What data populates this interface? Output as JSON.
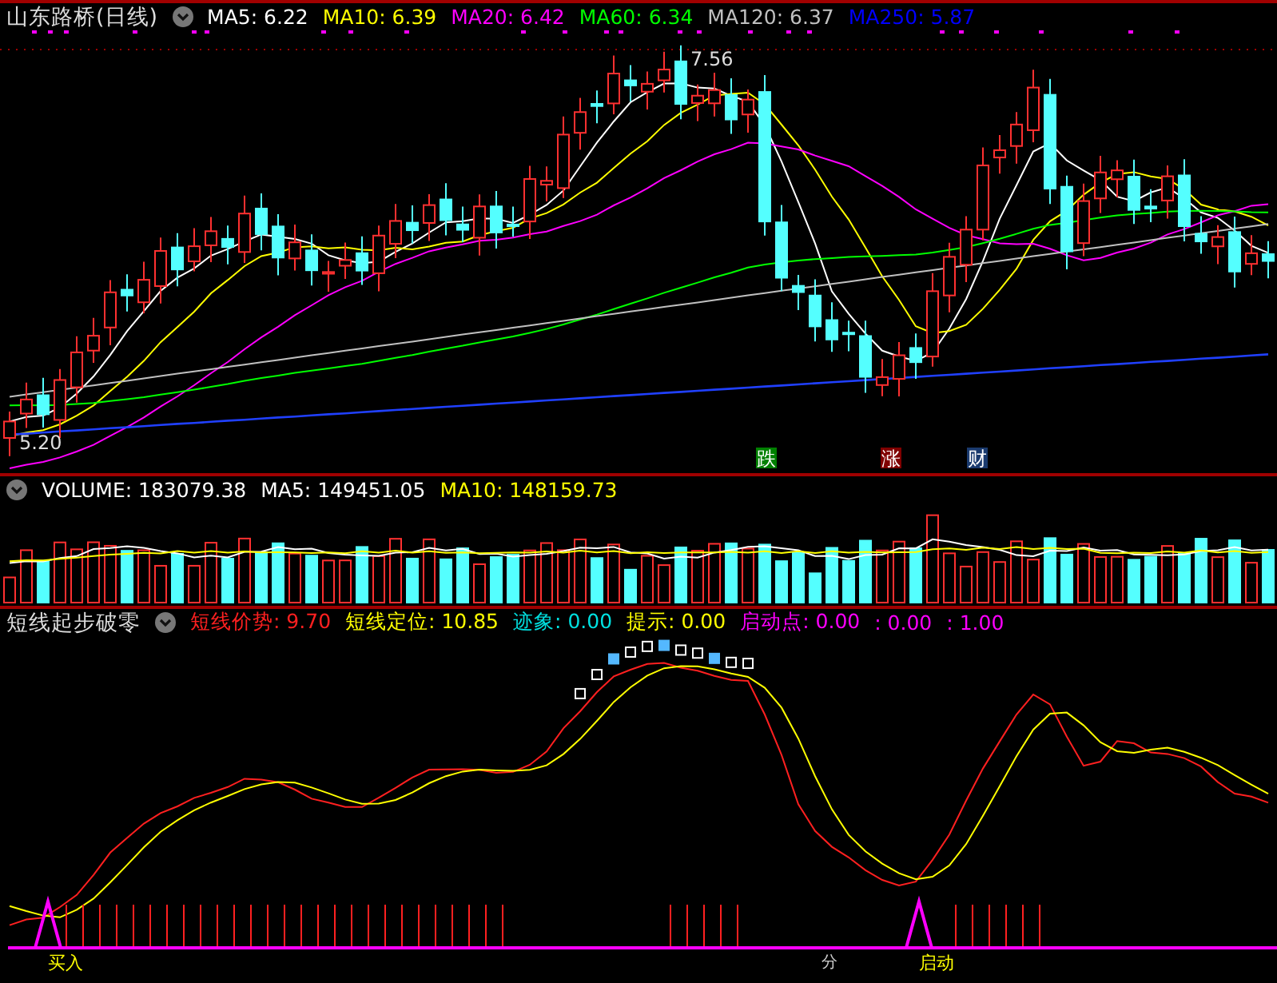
{
  "price_panel": {
    "title": "山东路桥(日线)",
    "indicators": [
      {
        "text": "MA5: 6.22",
        "color": "#ffffff"
      },
      {
        "text": "MA10: 6.39",
        "color": "#ffff00"
      },
      {
        "text": "MA20: 6.42",
        "color": "#ff00ff"
      },
      {
        "text": "MA60: 6.34",
        "color": "#00ff00"
      },
      {
        "text": "MA120: 6.37",
        "color": "#c0c0c0"
      },
      {
        "text": "MA250: 5.87",
        "color": "#0000ff"
      }
    ],
    "high_label": "7.56",
    "low_label": "5.20",
    "signals": [
      {
        "text": "跌",
        "color": "#008000"
      },
      {
        "text": "涨",
        "color": "#800000"
      },
      {
        "text": "财",
        "color": "#1a3a6e"
      }
    ]
  },
  "volume_panel": {
    "indicators": [
      {
        "text": "VOLUME: 183079.38",
        "color": "#ffffff"
      },
      {
        "text": "MA5: 149451.05",
        "color": "#ffffff"
      },
      {
        "text": "MA10: 148159.73",
        "color": "#ffff00"
      }
    ]
  },
  "indicator_panel": {
    "title": "短线起步破零",
    "indicators": [
      {
        "text": "短线价势: 9.70",
        "color": "#ff2020"
      },
      {
        "text": "短线定位: 10.85",
        "color": "#ffff00"
      },
      {
        "text": "迹象: 0.00",
        "color": "#00e0e0"
      },
      {
        "text": "提示: 0.00",
        "color": "#ffff00"
      },
      {
        "text": "启动点: 0.00",
        "color": "#ff00ff"
      },
      {
        "text": ": 0.00",
        "color": "#ff00ff"
      },
      {
        "text": ": 1.00",
        "color": "#ff00ff"
      }
    ],
    "marks": [
      {
        "text": "买入"
      },
      {
        "text": "分"
      },
      {
        "text": "启动"
      }
    ]
  }
}
